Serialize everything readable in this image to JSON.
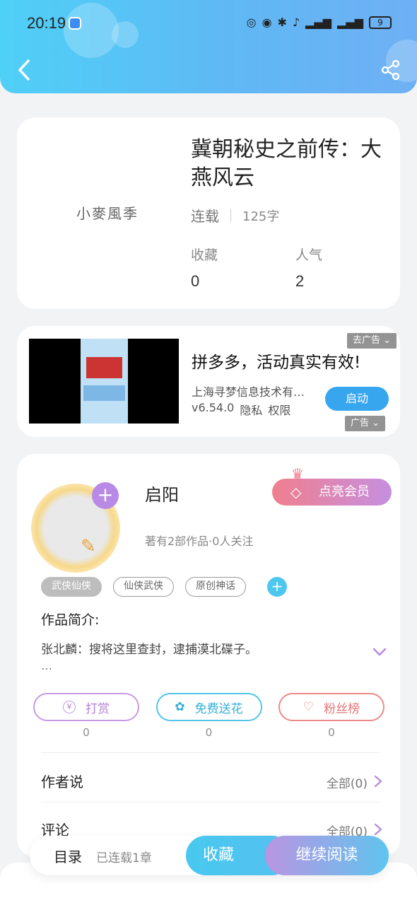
{
  "status_bar": {
    "time": "20:19",
    "battery": "9"
  },
  "book": {
    "cover_text": "小麥風季",
    "title": "冀朝秘史之前传：大燕风云",
    "status": "连载",
    "word_count": "125字",
    "favorites_label": "收藏",
    "favorites_value": "0",
    "popularity_label": "人气",
    "popularity_value": "2"
  },
  "ad": {
    "close_label": "去广告",
    "title": "拼多多，活动真实有效!",
    "company": "上海寻梦信息技术有…",
    "version": "v6.54.0",
    "privacy": "隐私",
    "permissions": "权限",
    "start_label": "启动",
    "ad_mark": "广告"
  },
  "author": {
    "name": "启阳",
    "info": "著有2部作品·0人关注",
    "vip_label": "点亮会员",
    "tags": [
      "武侠仙侠",
      "仙侠武侠",
      "原创神话"
    ],
    "intro_label": "作品简介:",
    "intro_text": "张北麟：搜将这里查封，逮捕漠北碟子。",
    "intro_more": "…"
  },
  "actions": {
    "reward_label": "打赏",
    "reward_count": "0",
    "flower_label": "免费送花",
    "flower_count": "0",
    "fans_label": "粉丝榜",
    "fans_count": "0"
  },
  "sections": {
    "author_says": "作者说",
    "author_says_all": "全部(0)",
    "comments": "评论",
    "comments_all": "全部(0)"
  },
  "bottom_bar": {
    "toc_label": "目录",
    "chapters": "已连载1章",
    "favorite_label": "收藏",
    "continue_label": "继续阅读"
  }
}
